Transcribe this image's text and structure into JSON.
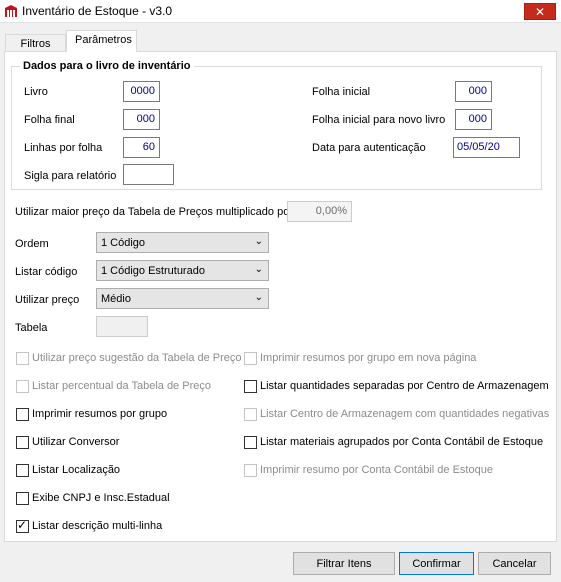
{
  "window": {
    "title": "Inventário de Estoque - v3.0",
    "close_symbol": "✕"
  },
  "tabs": [
    {
      "label": "Filtros"
    },
    {
      "label": "Parâmetros"
    }
  ],
  "group": {
    "title": "Dados para o livro de inventário",
    "livro": {
      "label": "Livro",
      "value": "0000"
    },
    "folha_final": {
      "label": "Folha final",
      "value": "000"
    },
    "linhas_por_folha": {
      "label": "Linhas por folha",
      "value": "60"
    },
    "sigla": {
      "label": "Sigla para relatório",
      "value": ""
    },
    "folha_inicial": {
      "label": "Folha inicial",
      "value": "000"
    },
    "folha_inicial_novo": {
      "label": "Folha inicial para novo livro",
      "value": "000"
    },
    "data_autenticacao": {
      "label": "Data para autenticação",
      "value": "05/05/20"
    }
  },
  "multiplier": {
    "label": "Utilizar maior preço da Tabela de Preços multiplicado por",
    "value": "0,00%"
  },
  "ordem": {
    "label": "Ordem",
    "value": "1 Código"
  },
  "listar_codigo": {
    "label": "Listar código",
    "value": "1 Código Estruturado"
  },
  "utilizar_preco": {
    "label": "Utilizar preço",
    "value": "Médio"
  },
  "tabela": {
    "label": "Tabela",
    "value": ""
  },
  "checkboxes_left": [
    {
      "label": "Utilizar preço sugestão da Tabela de Preço",
      "checked": false,
      "enabled": false
    },
    {
      "label": "Listar percentual da Tabela de Preço",
      "checked": false,
      "enabled": false
    },
    {
      "label": "Imprimir resumos por grupo",
      "checked": false,
      "enabled": true
    },
    {
      "label": "Utilizar Conversor",
      "checked": false,
      "enabled": true
    },
    {
      "label": "Listar Localização",
      "checked": false,
      "enabled": true
    },
    {
      "label": "Exibe CNPJ e Insc.Estadual",
      "checked": false,
      "enabled": true
    },
    {
      "label": "Listar descrição multi-linha",
      "checked": true,
      "enabled": true
    }
  ],
  "checkboxes_right": [
    {
      "label": "Imprimir resumos por grupo em nova página",
      "checked": false,
      "enabled": false
    },
    {
      "label": "Listar quantidades separadas por Centro de Armazenagem",
      "checked": false,
      "enabled": true
    },
    {
      "label": "Listar Centro de Armazenagem com quantidades negativas",
      "checked": false,
      "enabled": false
    },
    {
      "label": "Listar materiais agrupados por Conta Contábil de Estoque",
      "checked": false,
      "enabled": true
    },
    {
      "label": "Imprimir resumo por Conta Contábil de Estoque",
      "checked": false,
      "enabled": false
    }
  ],
  "buttons": {
    "filtrar": "Filtrar Itens",
    "confirmar": "Confirmar",
    "cancelar": "Cancelar"
  },
  "colors": {
    "value_text": "#00008b",
    "close_red": "#c42b1c",
    "app_icon_red": "#c0161b"
  }
}
